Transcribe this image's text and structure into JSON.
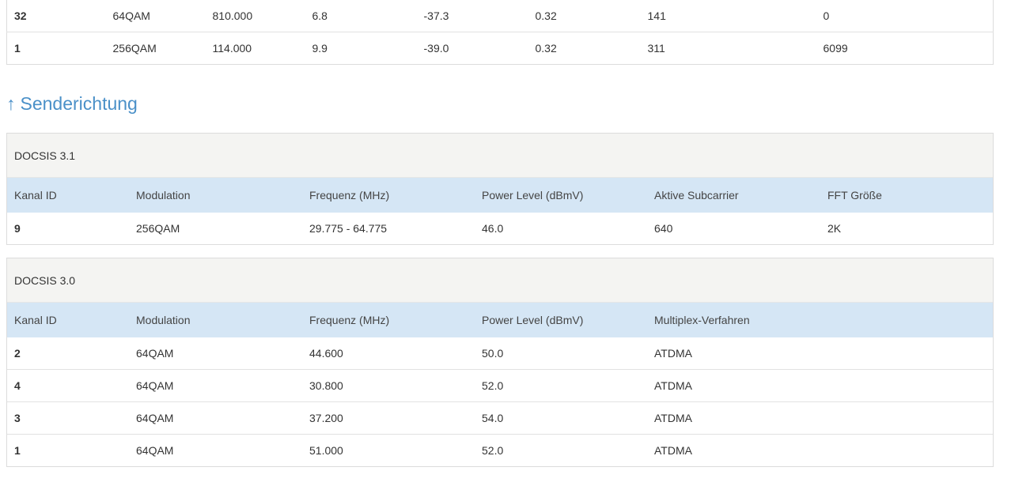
{
  "downstream_rows": [
    [
      "32",
      "64QAM",
      "810.000",
      "6.8",
      "-37.3",
      "0.32",
      "141",
      "0"
    ],
    [
      "1",
      "256QAM",
      "114.000",
      "9.9",
      "-39.0",
      "0.32",
      "311",
      "6099"
    ]
  ],
  "upstream": {
    "arrow": "↑",
    "heading": "Senderichtung",
    "docsis31": {
      "title": "DOCSIS 3.1",
      "headers": [
        "Kanal ID",
        "Modulation",
        "Frequenz (MHz)",
        "Power Level (dBmV)",
        "Aktive Subcarrier",
        "FFT Größe"
      ],
      "rows": [
        [
          "9",
          "256QAM",
          "29.775 - 64.775",
          "46.0",
          "640",
          "2K"
        ]
      ]
    },
    "docsis30": {
      "title": "DOCSIS 3.0",
      "headers": [
        "Kanal ID",
        "Modulation",
        "Frequenz (MHz)",
        "Power Level (dBmV)",
        "Multiplex-Verfahren"
      ],
      "rows": [
        [
          "2",
          "64QAM",
          "44.600",
          "50.0",
          "ATDMA"
        ],
        [
          "4",
          "64QAM",
          "30.800",
          "52.0",
          "ATDMA"
        ],
        [
          "3",
          "64QAM",
          "37.200",
          "54.0",
          "ATDMA"
        ],
        [
          "1",
          "64QAM",
          "51.000",
          "52.0",
          "ATDMA"
        ]
      ]
    }
  }
}
